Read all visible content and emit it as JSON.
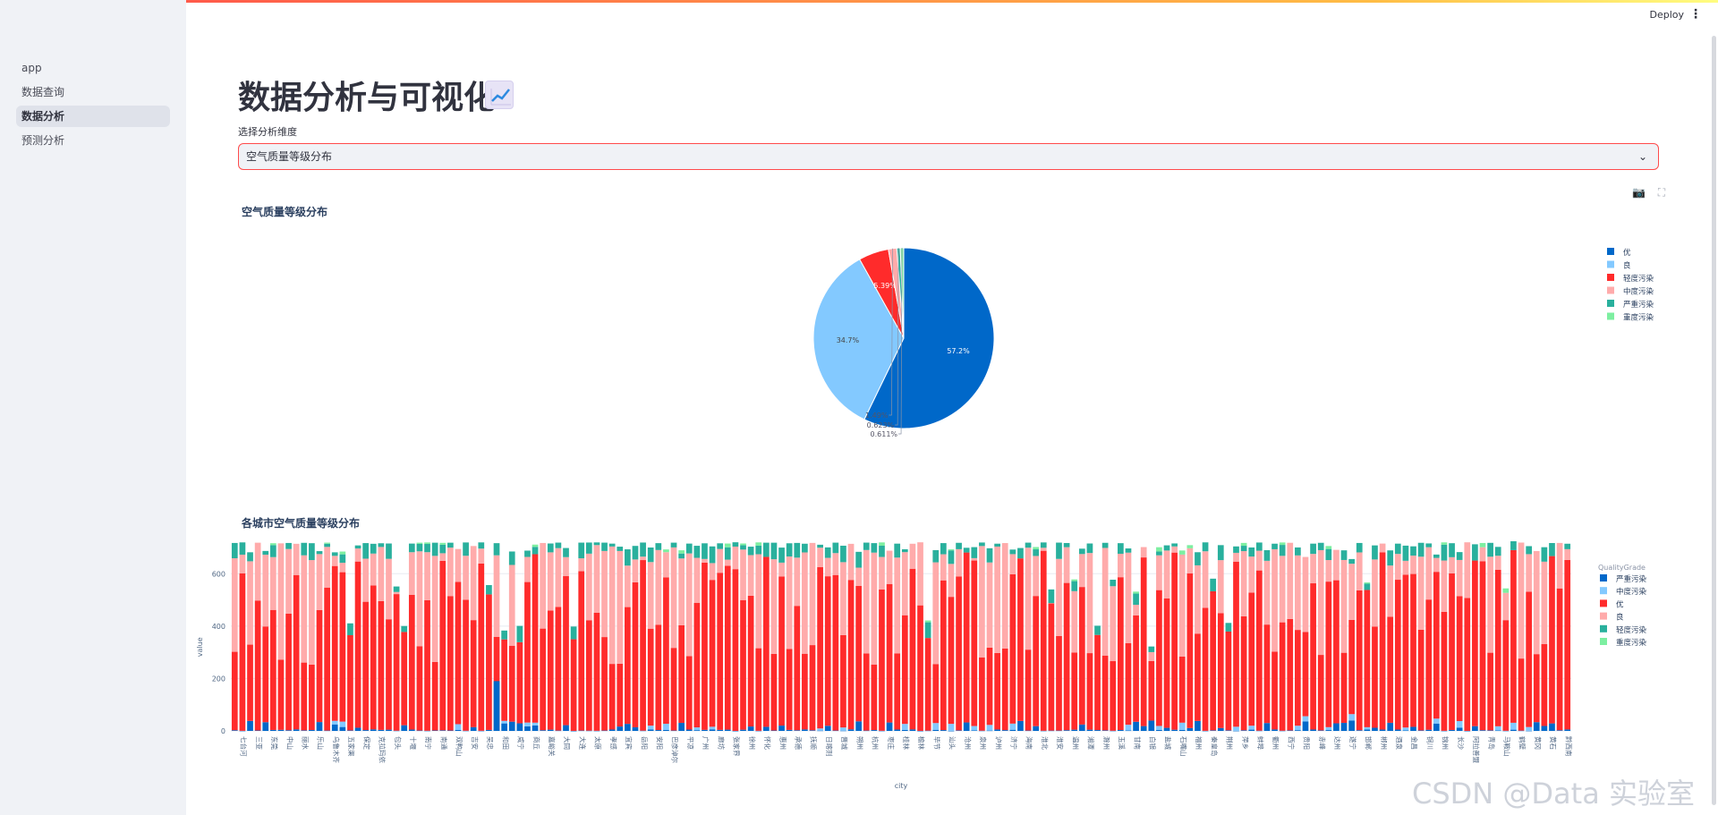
{
  "sidebar": {
    "items": [
      {
        "label": "app",
        "active": false
      },
      {
        "label": "数据查询",
        "active": false
      },
      {
        "label": "数据分析",
        "active": true
      },
      {
        "label": "预测分析",
        "active": false
      }
    ]
  },
  "header": {
    "deploy_label": "Deploy",
    "menu_icon": "more-vert-icon"
  },
  "main": {
    "title": "数据分析与可视化",
    "title_icon": "chart-increasing-icon",
    "select_label": "选择分析维度",
    "select_value": "空气质量等级分布"
  },
  "pie_chart": {
    "title": "空气质量等级分布"
  },
  "bar_chart": {
    "title": "各城市空气质量等级分布",
    "legend_title": "QualityGrade"
  },
  "watermark": "CSDN @Data 实验室",
  "colors": {
    "excellent": "#0068c9",
    "good": "#83c9ff",
    "light_pollution": "#ff2b2b",
    "moderate_pollution": "#ffabab",
    "severe_pollution": "#29b09d",
    "heavy_pollution": "#7defa1",
    "accent": "#ff4b4b"
  },
  "chart_data": [
    {
      "type": "pie",
      "title": "空气质量等级分布",
      "labels": [
        "优",
        "良",
        "轻度污染",
        "中度污染",
        "严重污染",
        "重度污染"
      ],
      "values": [
        57.2,
        34.7,
        5.39,
        1.49,
        0.623,
        0.611
      ],
      "value_labels": [
        "57.2%",
        "34.7%",
        "5.39%",
        "1.49%",
        "0.623%",
        "0.611%"
      ],
      "colors": [
        "#0068c9",
        "#83c9ff",
        "#ff2b2b",
        "#ffabab",
        "#29b09d",
        "#7defa1"
      ],
      "legend": "right"
    },
    {
      "type": "bar",
      "stacked": true,
      "title": "各城市空气质量等级分布",
      "xlabel": "city",
      "ylabel": "value",
      "ylim": [
        0,
        700
      ],
      "yticks": [
        0,
        200,
        400,
        600
      ],
      "legend_title": "QualityGrade",
      "legend": "right",
      "series": [
        {
          "name": "严重污染",
          "color": "#0068c9"
        },
        {
          "name": "中度污染",
          "color": "#83c9ff"
        },
        {
          "name": "优",
          "color": "#ff2b2b"
        },
        {
          "name": "良",
          "color": "#ffabab"
        },
        {
          "name": "轻度污染",
          "color": "#29b09d"
        },
        {
          "name": "重度污染",
          "color": "#7defa1"
        }
      ],
      "tick_labels": [
        "七台河",
        "三亚",
        "东莞",
        "中山",
        "丽水",
        "乐山",
        "乌鲁木齐",
        "五家渠",
        "保定",
        "克拉玛依",
        "包头",
        "十堰",
        "南宁",
        "南通",
        "双鸭山",
        "吉安",
        "吴忠",
        "和田",
        "咸宁",
        "商丘",
        "嘉峪关",
        "大同",
        "大连",
        "太原",
        "孝感",
        "宜宾",
        "岳阳",
        "安阳",
        "巴彦淖尔",
        "平凉",
        "广州",
        "廊坊",
        "张家界",
        "徐州",
        "怀化",
        "惠州",
        "承德",
        "抚顺",
        "日喀则",
        "晋城",
        "朔州",
        "杭州",
        "枣庄",
        "桂林",
        "榆林",
        "毕节",
        "汕头",
        "沧州",
        "泉州",
        "泸州",
        "济宁",
        "海南",
        "淮北",
        "淮安",
        "温州",
        "湘潭",
        "滁州",
        "玉溪",
        "甘南",
        "白银",
        "盐城",
        "石嘴山",
        "福州",
        "秦皇岛",
        "荆州",
        "萍乡",
        "蚌埠",
        "衢州",
        "西宁",
        "贵阳",
        "赤峰",
        "达州",
        "遂宁",
        "邯郸",
        "郴州",
        "酒泉",
        "金昌",
        "铜川",
        "锦州",
        "长沙",
        "阿拉善盟",
        "青岛",
        "马鞍山",
        "鹤壁",
        "黄冈",
        "黄石",
        "黔西南"
      ],
      "bar_count": 174,
      "bar_total_typical": 720
    }
  ]
}
